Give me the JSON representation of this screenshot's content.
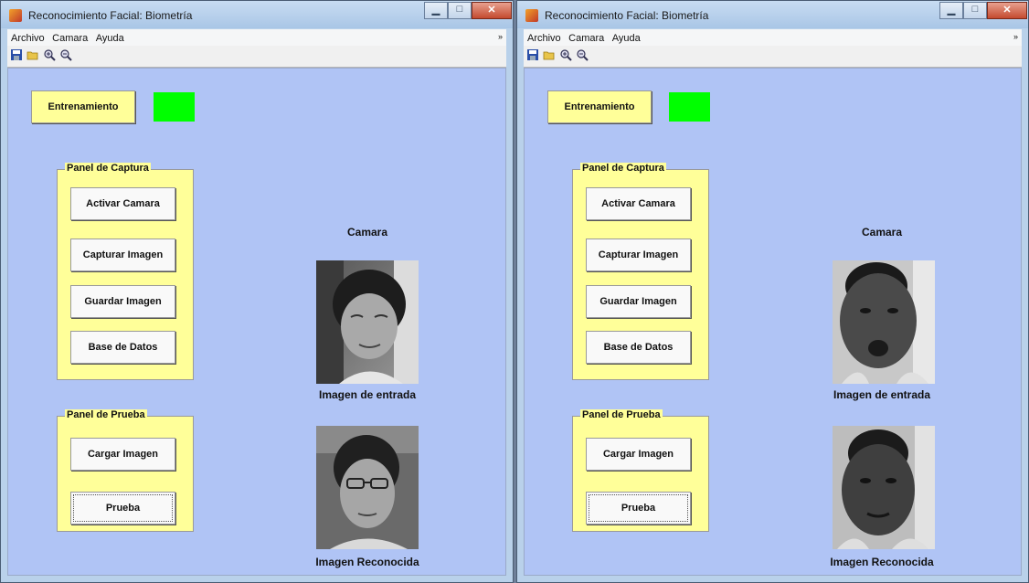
{
  "windows": [
    {
      "title": "Reconocimiento Facial: Biometría",
      "menu": [
        "Archivo",
        "Camara",
        "Ayuda"
      ],
      "menu_overflow": "»",
      "toolbar_icons": [
        "save-icon",
        "open-folder-icon",
        "zoom-in-icon",
        "zoom-out-icon"
      ],
      "training_button": "Entrenamiento",
      "indicator_color": "#00ff00",
      "capture_panel": {
        "title": "Panel de Captura",
        "buttons": [
          "Activar Camara",
          "Capturar Imagen",
          "Guardar  Imagen",
          "Base de Datos"
        ]
      },
      "test_panel": {
        "title": "Panel de Prueba",
        "buttons": [
          "Cargar Imagen",
          "Prueba"
        ]
      },
      "camera_label": "Camara",
      "input_label": "Imagen de entrada",
      "recognized_label": "Imagen Reconocida"
    },
    {
      "title": "Reconocimiento Facial: Biometría",
      "menu": [
        "Archivo",
        "Camara",
        "Ayuda"
      ],
      "menu_overflow": "»",
      "toolbar_icons": [
        "save-icon",
        "open-folder-icon",
        "zoom-in-icon",
        "zoom-out-icon"
      ],
      "training_button": "Entrenamiento",
      "indicator_color": "#00ff00",
      "capture_panel": {
        "title": "Panel de Captura",
        "buttons": [
          "Activar Camara",
          "Capturar Imagen",
          "Guardar  Imagen",
          "Base de Datos"
        ]
      },
      "test_panel": {
        "title": "Panel de Prueba",
        "buttons": [
          "Cargar Imagen",
          "Prueba"
        ]
      },
      "camera_label": "Camara",
      "input_label": "Imagen de entrada",
      "recognized_label": "Imagen Reconocida"
    }
  ]
}
